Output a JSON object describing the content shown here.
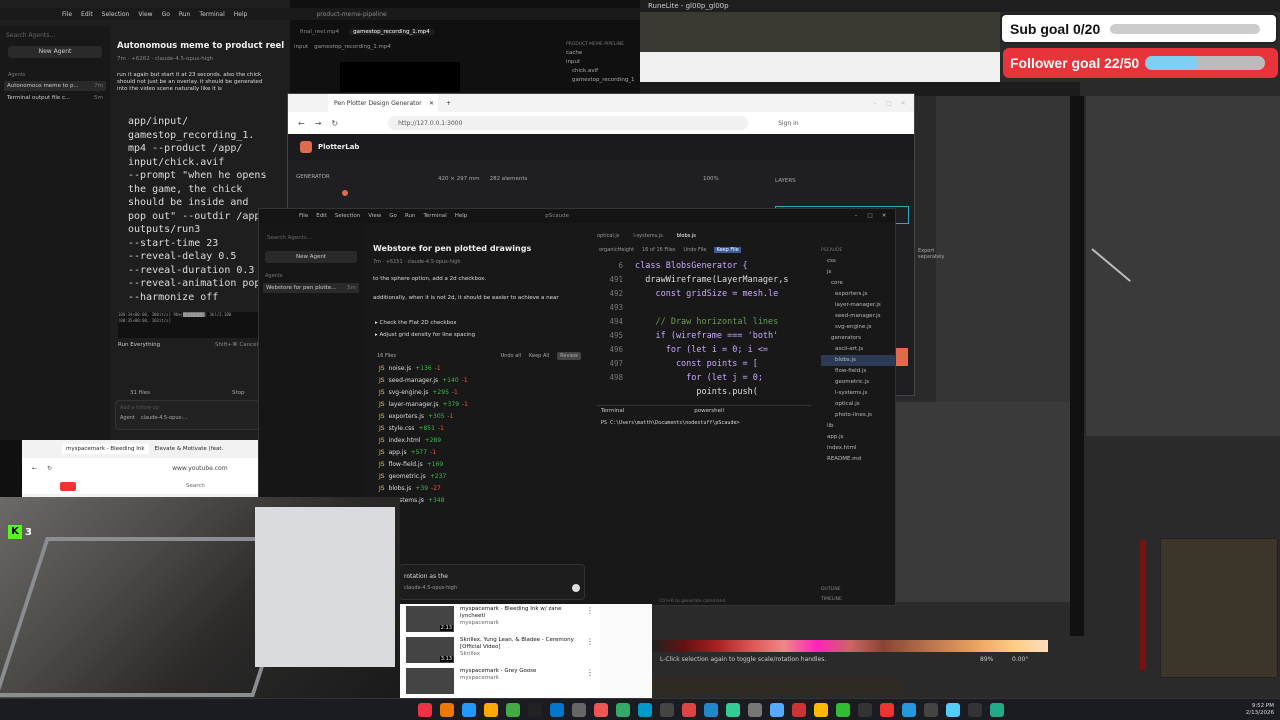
{
  "cursor_left": {
    "title": "product-meme-pipeline",
    "menu": [
      "File",
      "Edit",
      "Selection",
      "View",
      "Go",
      "Run",
      "Terminal",
      "Help"
    ],
    "search_placeholder": "Search Agents...",
    "new_agent": "New Agent",
    "agents_label": "Agents",
    "agents": [
      "Autonomous meme to p...",
      "Terminal output file c..."
    ],
    "agent_times": [
      "7m",
      "5m"
    ],
    "chat_title": "Autonomous meme to product reel gene...",
    "chat_meta": "7m · +6262 · claude-4.5-opus-high",
    "chat_msg": "run it again but start it at 23 seconds. also the chick should not just be an overlay. it should be generated into the video scene naturally like it is",
    "code_lines": [
      "app/input/",
      "gamestop_recording_1.",
      "mp4 --product /app/",
      "input/chick.avif",
      "--prompt \"when he opens",
      "the game, the chick",
      "should be inside and",
      "pop out\" --outdir /app/",
      "outputs/run3",
      "--start-time 23",
      "--reveal-delay 0.5",
      "--reveal-duration 0.3",
      "--reveal-animation pop",
      "--harmonize off"
    ],
    "run_everything": "Run Everything",
    "shortcut": "Shift+⌘ Cancel",
    "files_count": "31 files",
    "stop": "Stop",
    "followup": "Add a follow-up",
    "agent_mode": "Agent",
    "model": "claude-4.5-opus-...",
    "tabs": [
      "final_reel.mp4",
      "gamestop_recording_1.mp4"
    ],
    "breadcrumb": [
      "input",
      "gamestop_recording_1.mp4"
    ],
    "explorer_title": "PRODUCT-MEME-PIPELINE",
    "explorer": [
      "cache",
      "input",
      "chick.avif",
      "gamestop_recording_1"
    ]
  },
  "browser": {
    "tab_title": "Pen Plotter Design Generator",
    "url": "http://127.0.0.1:3000",
    "sign_in": "Sign in",
    "app_name": "PlotterLab",
    "generator": "GENERATOR",
    "canvas_info": "420 × 297 mm",
    "elements": "282 elements",
    "zoom": "100%",
    "layers": "LAYERS",
    "export_sep": "Export separately",
    "apply": "Apply"
  },
  "webstore": {
    "menu": [
      "File",
      "Edit",
      "Selection",
      "View",
      "Go",
      "Run",
      "Terminal",
      "Help"
    ],
    "title": "pScaude",
    "search_placeholder": "Search Agents...",
    "new_agent": "New Agent",
    "agents_label": "Agents",
    "agent_item": "Webstore for pen plotte...",
    "agent_time": "5m",
    "chat_title": "Webstore for pen plotted drawings",
    "chat_meta": "7m · +6151 · claude-4.5-opus-high",
    "msg1": "to the sphere option, add a 2d checkbox.",
    "msg2": "additionally, when it is not 2d, it should be easier to achieve a near",
    "task1": "Check the Flat 2D checkbox",
    "task2": "Adjust grid density for line spacing",
    "files_header": "16 Files",
    "undo_all": "Undo all",
    "keep_all": "Keep All",
    "review": "Review",
    "files": [
      {
        "name": "noise.js",
        "add": "+136",
        "del": "-1"
      },
      {
        "name": "seed-manager.js",
        "add": "+140",
        "del": "-1"
      },
      {
        "name": "svg-engine.js",
        "add": "+295",
        "del": "-1"
      },
      {
        "name": "layer-manager.js",
        "add": "+379",
        "del": "-1"
      },
      {
        "name": "exporters.js",
        "add": "+305",
        "del": "-1"
      },
      {
        "name": "style.css",
        "add": "+851",
        "del": "-1"
      },
      {
        "name": "index.html",
        "add": "+289",
        "del": ""
      },
      {
        "name": "app.js",
        "add": "+577",
        "del": "-1"
      },
      {
        "name": "flow-field.js",
        "add": "+169",
        "del": ""
      },
      {
        "name": "geometric.js",
        "add": "+237",
        "del": ""
      },
      {
        "name": "blobs.js",
        "add": "+39",
        "del": "-27"
      },
      {
        "name": "l-systems.js",
        "add": "+348",
        "del": ""
      }
    ],
    "input_text": "rotation as the",
    "model": "claude-4.5-opus-high",
    "editor_tabs": [
      "optical.js",
      "l-systems.js",
      "blobs.js"
    ],
    "crumbs": "organicHeight",
    "find": "16 of 16 Files",
    "undo_file": "Undo File",
    "keep_file": "Keep File",
    "line_numbers": [
      "6",
      "491",
      "492",
      "493",
      "494",
      "495",
      "496",
      "497",
      "498"
    ],
    "code": [
      "class BlobsGenerator {",
      "  drawWireframe(LayerManager,s",
      "    const gridSize = mesh.le",
      "",
      "    // Draw horizontal lines",
      "    if (wireframe === 'both'",
      "      for (let i = 0; i <=",
      "        const points = [",
      "          for (let j = 0;",
      "            points.push("
    ],
    "terminal_tab": "Terminal",
    "shell": "powershell",
    "prompt": "PS C:\\Users\\matth\\Documents\\nodestuff\\pScaude>",
    "explorer_title": "PSCAUDE",
    "explorer": [
      "css",
      "js",
      "core",
      "exporters.js",
      "layer-manager.js",
      "seed-manager.js",
      "svg-engine.js",
      "generators",
      "ascii-art.js",
      "blobs.js",
      "flow-field.js",
      "geometric.js",
      "l-systems.js",
      "optical.js",
      "photo-lines.js",
      "lib",
      "app.js",
      "index.html",
      "README.md"
    ],
    "outline": "OUTLINE",
    "timeline": "TIMELINE",
    "status": "Ctrl+K to generate command"
  },
  "youtube": {
    "tab1": "myspacemark - Bleeding Ink",
    "tab2": "Elevate & Motivate (feat.",
    "url": "www.youtube.com",
    "search": "Search",
    "videos": [
      {
        "title": "myspacemark - Bleeding Ink w/ zane lyncheeti",
        "channel": "myspacemark",
        "dur": "2:13"
      },
      {
        "title": "Skrillex, Yung Lean, & Bladee - Ceremony [Official Video]",
        "channel": "Skrillex",
        "dur": "3:13"
      },
      {
        "title": "myspacemark - Grey Goose",
        "channel": "myspacemark",
        "dur": ""
      }
    ]
  },
  "stream": {
    "sub_goal": "Sub goal 0/20",
    "follower_goal": "Follower goal 22/50",
    "follower_progress": 0.44,
    "kick_badge": "3"
  },
  "runelite": {
    "title": "RuneLite - gl00p_gl00p",
    "hint": "L-Click selection again to toggle scale/rotation handles.",
    "zoom": "89%",
    "angle": "0.00°"
  },
  "clock": {
    "time": "9:52 PM",
    "date": "2/13/2026"
  }
}
